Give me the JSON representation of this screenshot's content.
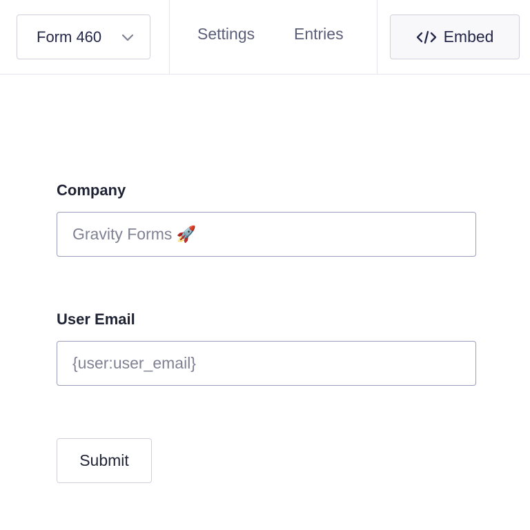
{
  "toolbar": {
    "form_selector": {
      "label": "Form 460",
      "icon": "chevron-down-icon"
    },
    "nav": [
      {
        "label": "Settings"
      },
      {
        "label": "Entries"
      }
    ],
    "embed": {
      "label": "Embed",
      "icon": "code-icon"
    }
  },
  "form": {
    "fields": [
      {
        "label": "Company",
        "value": "Gravity Forms 🚀"
      },
      {
        "label": "User Email",
        "value": "{user:user_email}"
      }
    ],
    "submit_label": "Submit"
  },
  "colors": {
    "text": "#1e2233",
    "muted_text": "#5b5e78",
    "input_border": "#9b9cbb",
    "border": "#cfd1dc",
    "divider": "#e6e7ee"
  }
}
